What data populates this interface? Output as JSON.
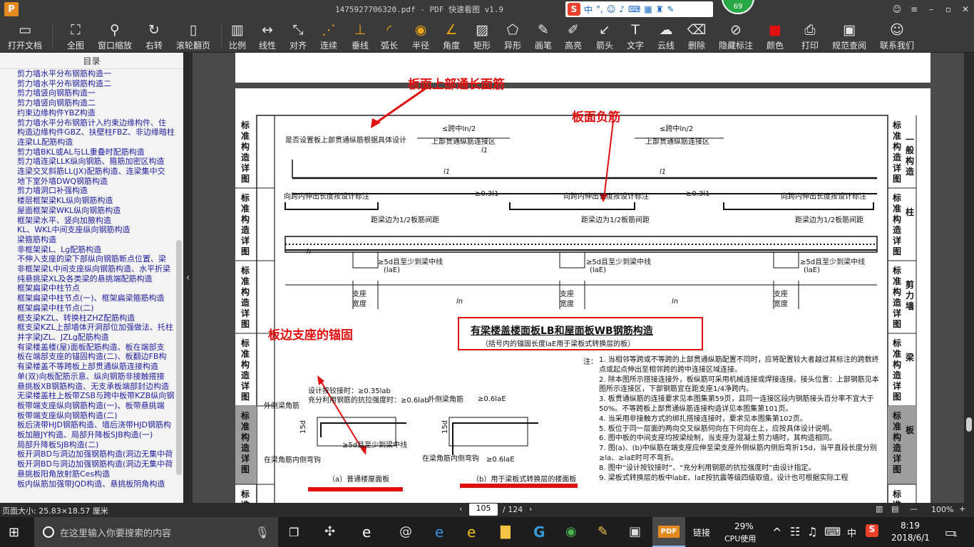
{
  "window": {
    "app_logo": "P",
    "title": "1475927706320.pdf - PDF 快速看图 v1.9",
    "notify_count": "69"
  },
  "toolbar": [
    {
      "id": "open",
      "label": "打开文档",
      "icon": "folder-icon"
    },
    {
      "id": "full",
      "label": "全图",
      "icon": "fullscreen-icon"
    },
    {
      "id": "zoomwin",
      "label": "窗口缩放",
      "icon": "magnifier-icon"
    },
    {
      "id": "rotate",
      "label": "右转",
      "icon": "rotate-right-icon"
    },
    {
      "id": "wheel",
      "label": "滚轮翻页",
      "icon": "mouse-icon"
    },
    {
      "id": "scale",
      "label": "比例",
      "icon": "ruler-icon"
    },
    {
      "id": "linear",
      "label": "线性",
      "icon": "linear-icon"
    },
    {
      "id": "align",
      "label": "对齐",
      "icon": "align-icon"
    },
    {
      "id": "chain",
      "label": "连续",
      "icon": "continuous-icon"
    },
    {
      "id": "perp",
      "label": "垂线",
      "icon": "perpendicular-icon"
    },
    {
      "id": "arc",
      "label": "弧长",
      "icon": "arc-icon"
    },
    {
      "id": "radius",
      "label": "半径",
      "icon": "radius-icon"
    },
    {
      "id": "angle",
      "label": "角度",
      "icon": "angle-icon"
    },
    {
      "id": "rect",
      "label": "矩形",
      "icon": "rectangle-icon"
    },
    {
      "id": "shape",
      "label": "异形",
      "icon": "irregular-icon"
    },
    {
      "id": "pen",
      "label": "画笔",
      "icon": "pen-icon"
    },
    {
      "id": "elev",
      "label": "高亮",
      "icon": "highlight-icon"
    },
    {
      "id": "arrow",
      "label": "箭头",
      "icon": "arrow-icon"
    },
    {
      "id": "text",
      "label": "文字",
      "icon": "text-icon"
    },
    {
      "id": "cloud",
      "label": "云线",
      "icon": "cloud-icon"
    },
    {
      "id": "delete",
      "label": "删除",
      "icon": "eraser-icon"
    },
    {
      "id": "hide",
      "label": "隐藏标注",
      "icon": "eye-hidden-icon"
    },
    {
      "id": "color",
      "label": "颜色",
      "icon": "color-swatch-icon"
    },
    {
      "id": "print",
      "label": "打印",
      "icon": "printer-icon"
    },
    {
      "id": "spec",
      "label": "规范查阅",
      "icon": "book-icon"
    },
    {
      "id": "contact",
      "label": "联系我们",
      "icon": "contact-icon"
    }
  ],
  "sidebar": {
    "title": "目录",
    "items": [
      "剪力墙水平分布钢筋构造一",
      "剪力墙水平分布钢筋构造二",
      "剪力墙竖向钢筋构造一",
      "剪力墙竖向钢筋构造二",
      "约束边缘构件YBZ构造",
      "剪力墙水平分布钢筋计入约束边缘构件、住",
      "构造边缘构件GBZ、扶壁柱FBZ、非边缘暗柱",
      "连梁LL配筋构造",
      "剪力墙BKL或AL与LL重叠时配筋构造",
      "剪力墙连梁LLK纵向钢筋、箍筋加密区构造",
      "连梁交叉斜筋LL(JX)配筋构造、连梁集中交",
      "地下室外墙DWQ钢筋构造",
      "剪力墙洞口补强构造",
      "楼层框架梁KL纵向钢筋构造",
      "屋面框架梁WKL纵向钢筋构造",
      "框架梁水平、竖向加腋构造",
      "KL、WKL中间支座纵向钢筋构造",
      "梁箍筋构造",
      "非框架梁L、Lg配筋构造",
      "不伸入支座的梁下部纵向钢筋断点位置、梁",
      "非框架梁L中间支座纵向钢筋构造、水平折梁",
      "纯悬挑梁XL及各类梁的悬挑端配筋构造",
      "框架扁梁中柱节点",
      "框架扁梁中柱节点(一)、框架扁梁箍筋构造",
      "框架扁梁中柱节点(二)",
      "框支梁KZL、转换柱ZHZ配筋构造",
      "框支梁KZL上部墙体开洞部位加强做法、托柱",
      "井字梁JZL、JZLg配筋构造",
      "有梁楼盖楼(屋)面板配筋构造、板在端部支",
      "板在端部支座的锚固构造(二)、板翻边FB构",
      "有梁楼盖不等跨板上部贯通纵筋连接构造",
      "单(双)向板配筋示意、纵向钢筋非接触搭接",
      "悬挑板XB钢筋构造、无支承板端部封边构造",
      "无梁楼盖柱上板带ZSB与跨中板带KZB纵向钢",
      "板带端支座纵向钢筋构造(一)、板带悬挑端",
      "板带端支座纵向钢筋构造(二)",
      "板后浇带HJD钢筋构造、墙后浇带HJD钢筋构",
      "板加腋JY构造、局部升降板SJB构造(一)",
      "局部升降板SJB构造(二)",
      "板开洞BD与洞边加强钢筋构造(洞边无集中荷",
      "板开洞BD与洞边加强钢筋构造(洞边无集中荷",
      "悬挑板阳角放射筋Ces构造",
      "板内纵筋加强带JQD构造、悬挑板阴角构造"
    ]
  },
  "doc": {
    "annot_top": "板面上部通长面筋",
    "annot_neg": "板面负筋",
    "annot_anchor": "板边支座的锚固",
    "note_design": "是否设置板上部贯通纵筋根据具体设计",
    "span_half": "≤跨中ln/2",
    "conn_zone": "上部贯通纵筋连接区",
    "span_sym": "ln",
    "l1": "l1",
    "ext_note": "向跨内伸出长度按设计标注",
    "ge03": "≥0.3l1",
    "dist_half": "距梁边为1/2板筋间距",
    "h": "h",
    "anchor5d": "≥5d且至少到梁中线",
    "la": "(laE)",
    "support": "支座",
    "width": "宽度",
    "main_title": "有梁楼盖楼面板LB和屋面板WB钢筋构造",
    "sub_title": "（括号内的锚固长度laE用于梁板式转换层的板）",
    "side_labels": [
      {
        "tag": "标准构造详图",
        "name": "一般构造"
      },
      {
        "tag": "标准构造详图",
        "name": "柱"
      },
      {
        "tag": "标准构造详图",
        "name": "剪力墙"
      },
      {
        "tag": "标准构造详图",
        "name": "梁"
      },
      {
        "tag": "标准构造详图",
        "name": "板"
      },
      {
        "tag": "标准构",
        "name": ""
      }
    ],
    "design_hinge": "设计按铰接时：≥0.35lab",
    "full_tension": "充分利用钢筋的抗拉强度时：≥0.6lab",
    "outer_bar": "外侧梁角筋",
    "d15": "15d",
    "inner_bend": "在梁角筋内侧弯钩",
    "ge06lae": "≥0.6laE",
    "cap_a": "（a）普通楼屋面板",
    "cap_b": "（b）用于梁板式转换层的楼面板",
    "notes_head": "注：",
    "notes": [
      "1. 当相邻等跨或不等跨的上部贯通纵筋配置不同时，应将配置较大者越过其标注的跨数终点或起点伸出至相邻跨的跨中连接区域连接。",
      "2. 除本图所示搭接连接外，板纵筋可采用机械连接或焊接连接。接头位置：上部钢筋见本图所示连接区，下部钢筋宜在距支座1/4净跨内。",
      "3. 板贯通纵筋的连接要求见本图集第59页，且同一连接区段内钢筋接头百分率不宜大于50%。不等跨板上部贯通纵筋连接构造详见本图集第101页。",
      "4. 当采用非接触方式的绑扎搭接连接时，要求见本图集第102页。",
      "5. 板位于同一层面的两向交叉纵筋何向在下何向在上，应按具体设计说明。",
      "6. 图中板的中间支座均按梁绘制，当支座为混凝土剪力墙时，其构造相同。",
      "7. 图(a)、(b)中纵筋在端支座应伸至梁支座外侧纵筋内侧后弯折15d，当平直段长度分别≥la、≥laE时可不弯折。",
      "8. 图中“设计按铰接时”、“充分利用钢筋的抗拉强度时”由设计指定。",
      "9. 梁板式转换层的板中labE、laE按抗震等级四级取值，设计也可根据实际工程"
    ]
  },
  "status": {
    "page_size": "页面大小: 25.83×18.57 厘米",
    "page_current": "105",
    "page_total": "/ 124",
    "zoom": "100%"
  },
  "taskbar": {
    "search_placeholder": "在这里输入你要搜索的内容",
    "app_active": "PDF",
    "link": "链接",
    "cpu_pct": "29%",
    "cpu_label": "CPU使用",
    "ime_lang": "中",
    "time": "8:19",
    "date": "2018/6/1",
    "notif_count": "1"
  }
}
